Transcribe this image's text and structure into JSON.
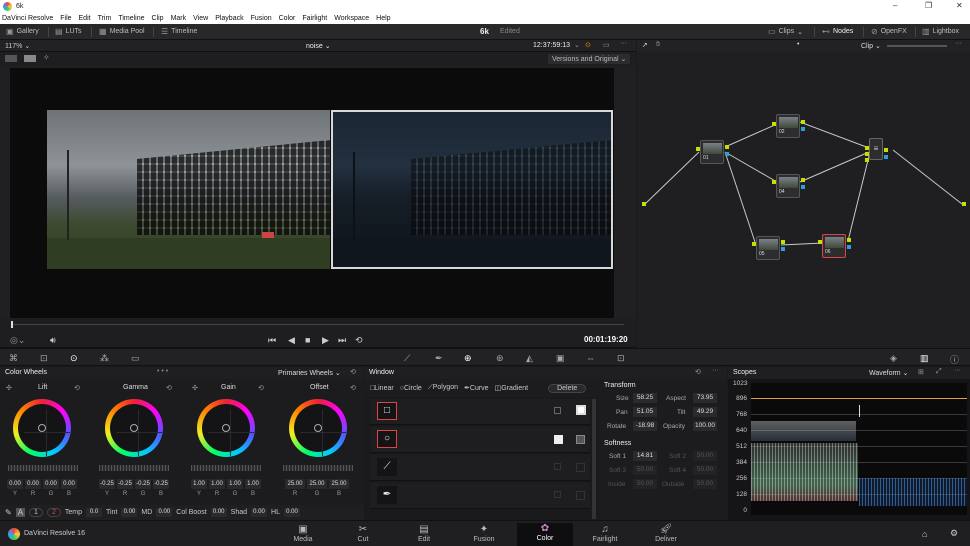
{
  "window": {
    "title": "6k",
    "controls": [
      "–",
      "❐",
      "✕"
    ]
  },
  "menu": [
    "DaVinci Resolve",
    "File",
    "Edit",
    "Trim",
    "Timeline",
    "Clip",
    "Mark",
    "View",
    "Playback",
    "Fusion",
    "Color",
    "Fairlight",
    "Workspace",
    "Help"
  ],
  "toolbar": {
    "gallery": "Gallery",
    "luts": "LUTs",
    "media_pool": "Media Pool",
    "timeline": "Timeline",
    "project": "6k",
    "status": "Edited",
    "clips": "Clips",
    "nodes": "Nodes",
    "openfx": "OpenFX",
    "lightbox": "Lightbox"
  },
  "viewer": {
    "zoom": "117%",
    "clip_name": "noise",
    "timecode": "12:37:59:13",
    "compare_mode": "Versions and Original",
    "playhead_timecode": "00:01:19:20"
  },
  "node_editor": {
    "mode": "Clip",
    "nodes": [
      "01",
      "02",
      "04",
      "05",
      "06"
    ]
  },
  "color_wheels": {
    "title": "Color Wheels",
    "mode": "Primaries Wheels",
    "wheels": [
      {
        "label": "Lift",
        "values": [
          "0.00",
          "0.00",
          "0.00",
          "0.00"
        ]
      },
      {
        "label": "Gamma",
        "values": [
          "-0.25",
          "-0.25",
          "-0.25",
          "-0.25"
        ]
      },
      {
        "label": "Gain",
        "values": [
          "1.00",
          "1.00",
          "1.00",
          "1.00"
        ]
      },
      {
        "label": "Offset",
        "values": [
          "25.00",
          "25.00",
          "25.00"
        ]
      }
    ],
    "channels4": [
      "Y",
      "R",
      "G",
      "B"
    ],
    "channels3": [
      "R",
      "G",
      "B"
    ]
  },
  "adjust_bar": {
    "page1": "1",
    "page2": "2",
    "temp_label": "Temp",
    "temp": "0.0",
    "tint_label": "Tint",
    "tint": "0.00",
    "md_label": "MD",
    "md": "0.00",
    "colboost_label": "Col Boost",
    "colboost": "0.00",
    "shad_label": "Shad",
    "shad": "0.00",
    "hl_label": "HL",
    "hl": "0.00"
  },
  "window_panel": {
    "title": "Window",
    "tools": [
      "Linear",
      "Circle",
      "Polygon",
      "Curve",
      "Gradient"
    ],
    "delete": "Delete"
  },
  "transform": {
    "title": "Transform",
    "size_label": "Size",
    "size": "58.25",
    "aspect_label": "Aspect",
    "aspect": "73.95",
    "pan_label": "Pan",
    "pan": "51.05",
    "tilt_label": "Tilt",
    "tilt": "49.29",
    "rotate_label": "Rotate",
    "rotate": "-18.98",
    "opacity_label": "Opacity",
    "opacity": "100.00",
    "softness_title": "Softness",
    "soft1_label": "Soft 1",
    "soft1": "14.81",
    "soft2_label": "Soft 2",
    "soft2": "50.00",
    "soft3_label": "Soft 3",
    "soft3": "50.00",
    "soft4_label": "Soft 4",
    "soft4": "50.00",
    "inside_label": "Inside",
    "inside": "50.00",
    "outside_label": "Outside",
    "outside": "50.00"
  },
  "scopes": {
    "title": "Scopes",
    "mode": "Waveform",
    "y_ticks": [
      "1023",
      "896",
      "768",
      "640",
      "512",
      "384",
      "256",
      "128",
      "0"
    ]
  },
  "status": {
    "app": "DaVinci Resolve 16"
  },
  "pages": [
    "Media",
    "Cut",
    "Edit",
    "Fusion",
    "Color",
    "Fairlight",
    "Deliver"
  ],
  "active_page": "Color",
  "colors": {
    "accent": "#d44444",
    "node_link": "#c8e000",
    "node_input": "#2a9fd8"
  }
}
